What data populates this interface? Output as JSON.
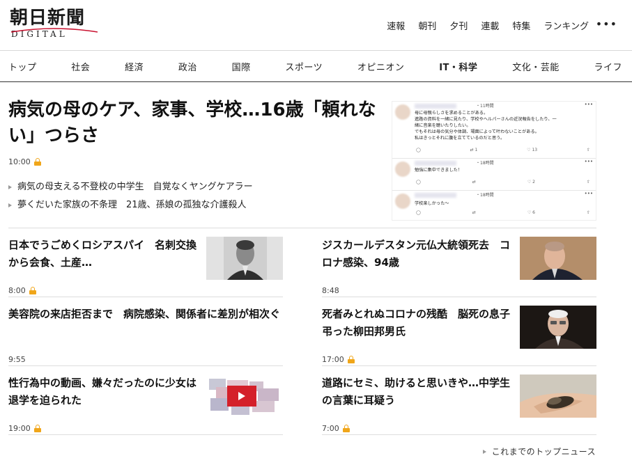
{
  "header": {
    "logo_main": "朝日新聞",
    "logo_sub": "DIGITAL",
    "top_links": [
      "速報",
      "朝刊",
      "夕刊",
      "連載",
      "特集",
      "ランキング"
    ],
    "more_icon": "more-horizontal-icon"
  },
  "nav": [
    "トップ",
    "社会",
    "経済",
    "政治",
    "国際",
    "スポーツ",
    "オピニオン",
    "IT・科学",
    "文化・芸能",
    "ライフ"
  ],
  "lead": {
    "title": "病気の母のケア、家事、学校…16歳「頼れない」つらさ",
    "time": "10:00",
    "related": [
      "病気の母支える不登校の中学生　自覚なくヤングケアラー",
      "夢くだいた家族の不条理　21歳、孫娘の孤独な介護殺人"
    ],
    "tweets": [
      {
        "time": "・11時間",
        "text": "母に母親らしさを求めることがある。\n進路の資料を一緒に見たり、学校やヘルパーさんの近況報告をしたり、一\n緒に音楽を聴いたりしたい。\nでもそれは母の気分や体調、場面によって叶わないことがある。\n私はきっとそれに腹を立てているのだと思う。",
        "counts": [
          "",
          "1",
          "13",
          ""
        ]
      },
      {
        "time": "・18時間",
        "text": "勉強に集中できました！",
        "counts": [
          "",
          "",
          "2",
          ""
        ]
      },
      {
        "time": "・18時間",
        "text": "学校楽しかった〜",
        "counts": [
          "",
          "",
          "6",
          ""
        ]
      }
    ]
  },
  "articles": [
    {
      "title": "日本でうごめくロシアスパイ　名刺交換から会食、土産…",
      "time": "8:00",
      "locked": true,
      "thumb": "portrait-photo"
    },
    {
      "title": "ジスカールデスタン元仏大統領死去　コロナ感染、94歳",
      "time": "8:48",
      "locked": false,
      "thumb": "portrait-photo"
    },
    {
      "title": "美容院の来店拒否まで　病院感染、関係者に差別が相次ぐ",
      "time": "9:55",
      "locked": false,
      "thumb": ""
    },
    {
      "title": "死者みとれぬコロナの残酷　脳死の息子弔った柳田邦男氏",
      "time": "17:00",
      "locked": true,
      "thumb": "portrait-photo"
    },
    {
      "title": "性行為中の動画、嫌々だったのに少女は退学を迫られた",
      "time": "19:00",
      "locked": true,
      "thumb": "video-collage"
    },
    {
      "title": "道路にセミ、助けると思いきや…中学生の言葉に耳疑う",
      "time": "7:00",
      "locked": true,
      "thumb": "cicada-photo"
    }
  ],
  "more_news": "これまでのトップニュース"
}
